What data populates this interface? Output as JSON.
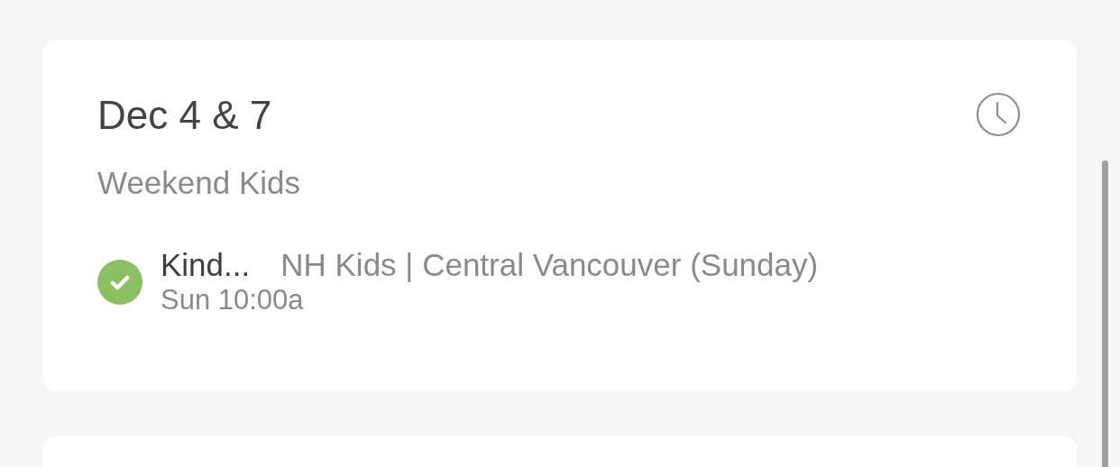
{
  "cards": [
    {
      "title": "Dec 4 & 7",
      "subtitle": "Weekend Kids",
      "assignments": [
        {
          "confirmed": true,
          "position": "Kind...",
          "service": "NH Kids | Central Vancouver (Sunday)",
          "time": "Sun 10:00a"
        }
      ]
    }
  ]
}
